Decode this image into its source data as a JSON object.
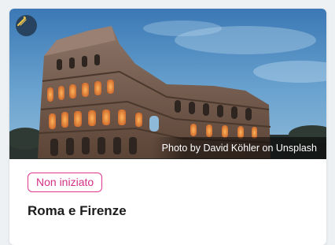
{
  "card": {
    "photo_credit": "Photo by David Köhler on Unsplash",
    "badge_icon": "magic-wand-icon",
    "status": "Non iniziato",
    "title": "Roma e Firenze"
  },
  "colors": {
    "status_border": "#e0368f",
    "status_text": "#d42f85",
    "badge_bg": "#27435f",
    "badge_icon": "#f2c94c"
  }
}
